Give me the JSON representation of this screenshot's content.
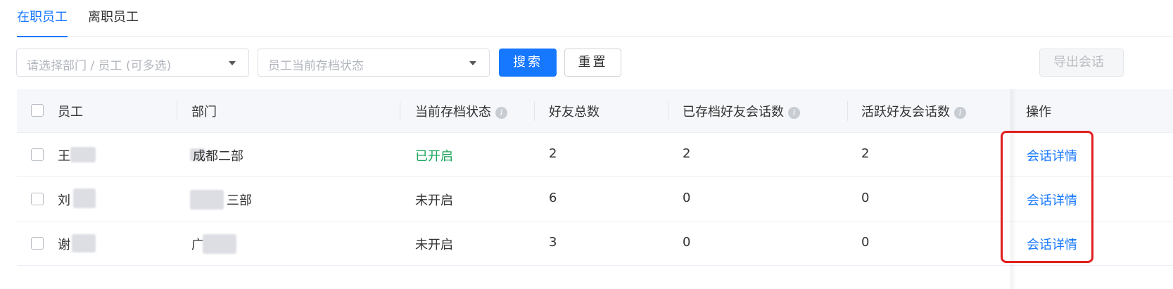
{
  "tabs": [
    {
      "label": "在职员工",
      "active": true
    },
    {
      "label": "离职员工",
      "active": false
    }
  ],
  "filters": {
    "dept_placeholder": "请选择部门 / 员工 (可多选)",
    "status_placeholder": "员工当前存档状态",
    "search_label": "搜索",
    "reset_label": "重置",
    "export_label": "导出会话"
  },
  "table": {
    "columns": [
      "员工",
      "部门",
      "当前存档状态",
      "好友总数",
      "已存档好友会话数",
      "活跃好友会话数",
      "操作"
    ],
    "rows": [
      {
        "employee": "王",
        "department": "成都二部",
        "status": "已开启",
        "friends": "2",
        "archived": "2",
        "active": "2",
        "action": "会话详情"
      },
      {
        "employee": "刘",
        "department": "三部",
        "status": "未开启",
        "friends": "6",
        "archived": "0",
        "active": "0",
        "action": "会话详情"
      },
      {
        "employee": "谢",
        "department": "广",
        "status": "未开启",
        "friends": "3",
        "archived": "0",
        "active": "0",
        "action": "会话详情"
      }
    ]
  },
  "colors": {
    "accent": "#1677ff",
    "status_on": "#19a55a",
    "highlight": "#e0201f"
  }
}
